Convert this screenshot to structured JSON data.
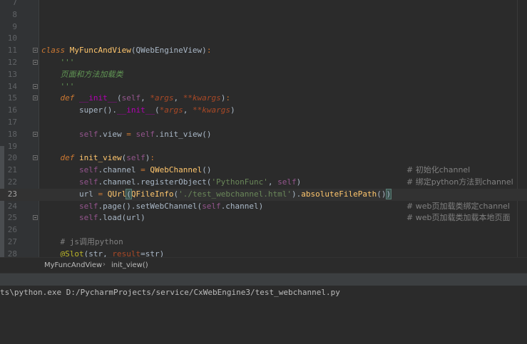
{
  "editor": {
    "lines": [
      {
        "num": "7",
        "code": [],
        "comment": ""
      },
      {
        "num": "8",
        "code": [],
        "comment": ""
      },
      {
        "num": "9",
        "code": [],
        "comment": ""
      },
      {
        "num": "10",
        "code": [],
        "comment": ""
      },
      {
        "num": "11",
        "fold": true,
        "code": [
          {
            "t": "class",
            "c": "it-kw"
          },
          {
            "t": " "
          },
          {
            "t": "MyFuncAndView",
            "c": "cls"
          },
          {
            "t": "(QWebEngineView)"
          },
          {
            "t": ":",
            "c": "kw"
          }
        ],
        "comment": ""
      },
      {
        "num": "12",
        "fold": true,
        "code": [
          {
            "t": "    "
          },
          {
            "t": "'''",
            "c": "doc"
          }
        ],
        "comment": ""
      },
      {
        "num": "13",
        "code": [
          {
            "t": "    "
          },
          {
            "t": "页面和方法加载类",
            "c": "doc"
          }
        ],
        "comment": ""
      },
      {
        "num": "14",
        "fold": true,
        "code": [
          {
            "t": "    "
          },
          {
            "t": "'''",
            "c": "doc"
          }
        ],
        "comment": ""
      },
      {
        "num": "15",
        "fold": true,
        "code": [
          {
            "t": "    "
          },
          {
            "t": "def",
            "c": "it-kw"
          },
          {
            "t": " "
          },
          {
            "t": "__init__",
            "c": "magic"
          },
          {
            "t": "("
          },
          {
            "t": "self",
            "c": "self"
          },
          {
            "t": ", "
          },
          {
            "t": "*args",
            "c": "param"
          },
          {
            "t": ", "
          },
          {
            "t": "**kwargs",
            "c": "param"
          },
          {
            "t": ")"
          },
          {
            "t": ":",
            "c": "kw"
          }
        ],
        "comment": ""
      },
      {
        "num": "16",
        "code": [
          {
            "t": "        "
          },
          {
            "t": "super"
          },
          {
            "t": "()."
          },
          {
            "t": "__init__",
            "c": "magic"
          },
          {
            "t": "("
          },
          {
            "t": "*args",
            "c": "param"
          },
          {
            "t": ", "
          },
          {
            "t": "**kwargs",
            "c": "param"
          },
          {
            "t": ")"
          }
        ],
        "comment": ""
      },
      {
        "num": "17",
        "code": [],
        "comment": ""
      },
      {
        "num": "18",
        "fold": true,
        "code": [
          {
            "t": "        "
          },
          {
            "t": "self",
            "c": "self"
          },
          {
            "t": ".view "
          },
          {
            "t": "=",
            "c": "kw"
          },
          {
            "t": " "
          },
          {
            "t": "self",
            "c": "self"
          },
          {
            "t": ".init_view()"
          }
        ],
        "comment": ""
      },
      {
        "num": "19",
        "code": [],
        "comment": ""
      },
      {
        "num": "20",
        "fold": true,
        "code": [
          {
            "t": "    "
          },
          {
            "t": "def",
            "c": "it-kw"
          },
          {
            "t": " "
          },
          {
            "t": "init_view",
            "c": "fn"
          },
          {
            "t": "("
          },
          {
            "t": "self",
            "c": "self"
          },
          {
            "t": ")"
          },
          {
            "t": ":",
            "c": "kw"
          }
        ],
        "comment": ""
      },
      {
        "num": "21",
        "code": [
          {
            "t": "        "
          },
          {
            "t": "self",
            "c": "self"
          },
          {
            "t": ".channel "
          },
          {
            "t": "=",
            "c": "kw"
          },
          {
            "t": " "
          },
          {
            "t": "QWebChannel",
            "c": "fn"
          },
          {
            "t": "()"
          }
        ],
        "comment": "# 初始化channel"
      },
      {
        "num": "22",
        "code": [
          {
            "t": "        "
          },
          {
            "t": "self",
            "c": "self"
          },
          {
            "t": ".channel.registerObject("
          },
          {
            "t": "'PythonFunc'",
            "c": "str"
          },
          {
            "t": ", "
          },
          {
            "t": "self",
            "c": "self"
          },
          {
            "t": ")"
          }
        ],
        "comment": "# 绑定python方法到channel"
      },
      {
        "num": "23",
        "current": true,
        "code": [
          {
            "t": "        url "
          },
          {
            "t": "=",
            "c": "kw"
          },
          {
            "t": " "
          },
          {
            "t": "QUrl",
            "c": "fn"
          },
          {
            "t": "(",
            "c": "hl-brace"
          },
          {
            "t": "QFileInfo",
            "c": "fn"
          },
          {
            "t": "("
          },
          {
            "t": "'./test_webchannel.html'",
            "c": "str"
          },
          {
            "t": ")."
          },
          {
            "t": "absoluteFilePath",
            "c": "fn"
          },
          {
            "t": "()"
          },
          {
            "t": ")",
            "c": "hl-brace"
          }
        ],
        "comment": ""
      },
      {
        "num": "24",
        "code": [
          {
            "t": "        "
          },
          {
            "t": "self",
            "c": "self"
          },
          {
            "t": ".page().setWebChannel("
          },
          {
            "t": "self",
            "c": "self"
          },
          {
            "t": ".channel)"
          }
        ],
        "comment": "# web页加载类绑定channel"
      },
      {
        "num": "25",
        "fold": true,
        "code": [
          {
            "t": "        "
          },
          {
            "t": "self",
            "c": "self"
          },
          {
            "t": ".load(url)"
          }
        ],
        "comment": "# web页加载类加载本地页面"
      },
      {
        "num": "26",
        "code": [],
        "comment": ""
      },
      {
        "num": "27",
        "code": [
          {
            "t": "    "
          },
          {
            "t": "# js调用python",
            "c": "cm"
          }
        ],
        "comment": ""
      },
      {
        "num": "28",
        "code": [
          {
            "t": "    "
          },
          {
            "t": "@Slot",
            "c": "deco"
          },
          {
            "t": "(str, "
          },
          {
            "t": "result",
            "c": "named"
          },
          {
            "t": "="
          },
          {
            "t": "str"
          },
          {
            "t": ")"
          }
        ],
        "comment": ""
      }
    ]
  },
  "breadcrumb": {
    "items": [
      "MyFuncAndView",
      "init_view()"
    ],
    "separator": "›"
  },
  "console": {
    "line": "ts\\python.exe D:/PycharmProjects/service/CxWebEngine3/test_webchannel.py"
  },
  "colors": {
    "editor_bg": "#2b2b2b",
    "gutter_bg": "#313335",
    "keyword": "#cc7832",
    "string": "#6a8759",
    "function": "#ffc66d",
    "self": "#94558d",
    "comment": "#808080"
  }
}
